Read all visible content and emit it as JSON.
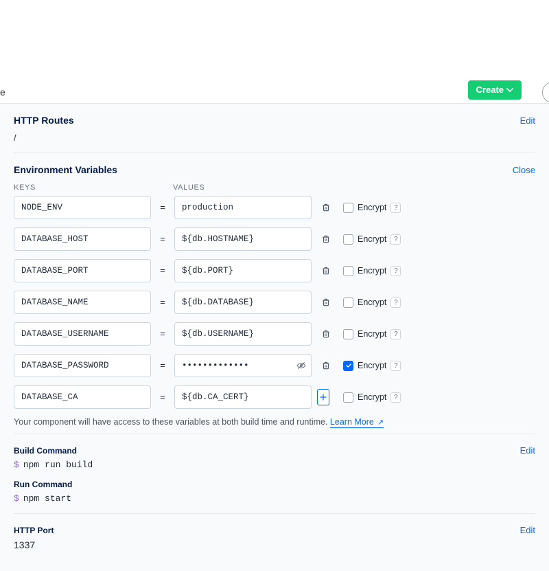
{
  "topbar": {
    "cut_letter": "e",
    "create_label": "Create"
  },
  "http_routes": {
    "title": "HTTP Routes",
    "edit_label": "Edit",
    "path": "/"
  },
  "env": {
    "title": "Environment Variables",
    "close_label": "Close",
    "keys_label": "KEYS",
    "values_label": "VALUES",
    "encrypt_label": "Encrypt",
    "rows": [
      {
        "key": "NODE_ENV",
        "value": "production",
        "encrypt": false,
        "type": "text",
        "trailing": "trash"
      },
      {
        "key": "DATABASE_HOST",
        "value": "${db.HOSTNAME}",
        "encrypt": false,
        "type": "text",
        "trailing": "trash"
      },
      {
        "key": "DATABASE_PORT",
        "value": "${db.PORT}",
        "encrypt": false,
        "type": "text",
        "trailing": "trash"
      },
      {
        "key": "DATABASE_NAME",
        "value": "${db.DATABASE}",
        "encrypt": false,
        "type": "text",
        "trailing": "trash"
      },
      {
        "key": "DATABASE_USERNAME",
        "value": "${db.USERNAME}",
        "encrypt": false,
        "type": "text",
        "trailing": "trash"
      },
      {
        "key": "DATABASE_PASSWORD",
        "value": "•••••••••••••",
        "encrypt": true,
        "type": "password",
        "trailing": "trash",
        "has_eye": true
      },
      {
        "key": "DATABASE_CA",
        "value": "${db.CA_CERT}",
        "encrypt": false,
        "type": "text",
        "trailing": "add"
      }
    ],
    "hint_prefix": "Your component will have access to these variables at both build time and runtime. ",
    "learn_more": "Learn More"
  },
  "build_cmd": {
    "title": "Build Command",
    "edit_label": "Edit",
    "prompt": "$",
    "cmd": "npm run build"
  },
  "run_cmd": {
    "title": "Run Command",
    "prompt": "$",
    "cmd": "npm start"
  },
  "http_port": {
    "title": "HTTP Port",
    "edit_label": "Edit",
    "value": "1337"
  }
}
